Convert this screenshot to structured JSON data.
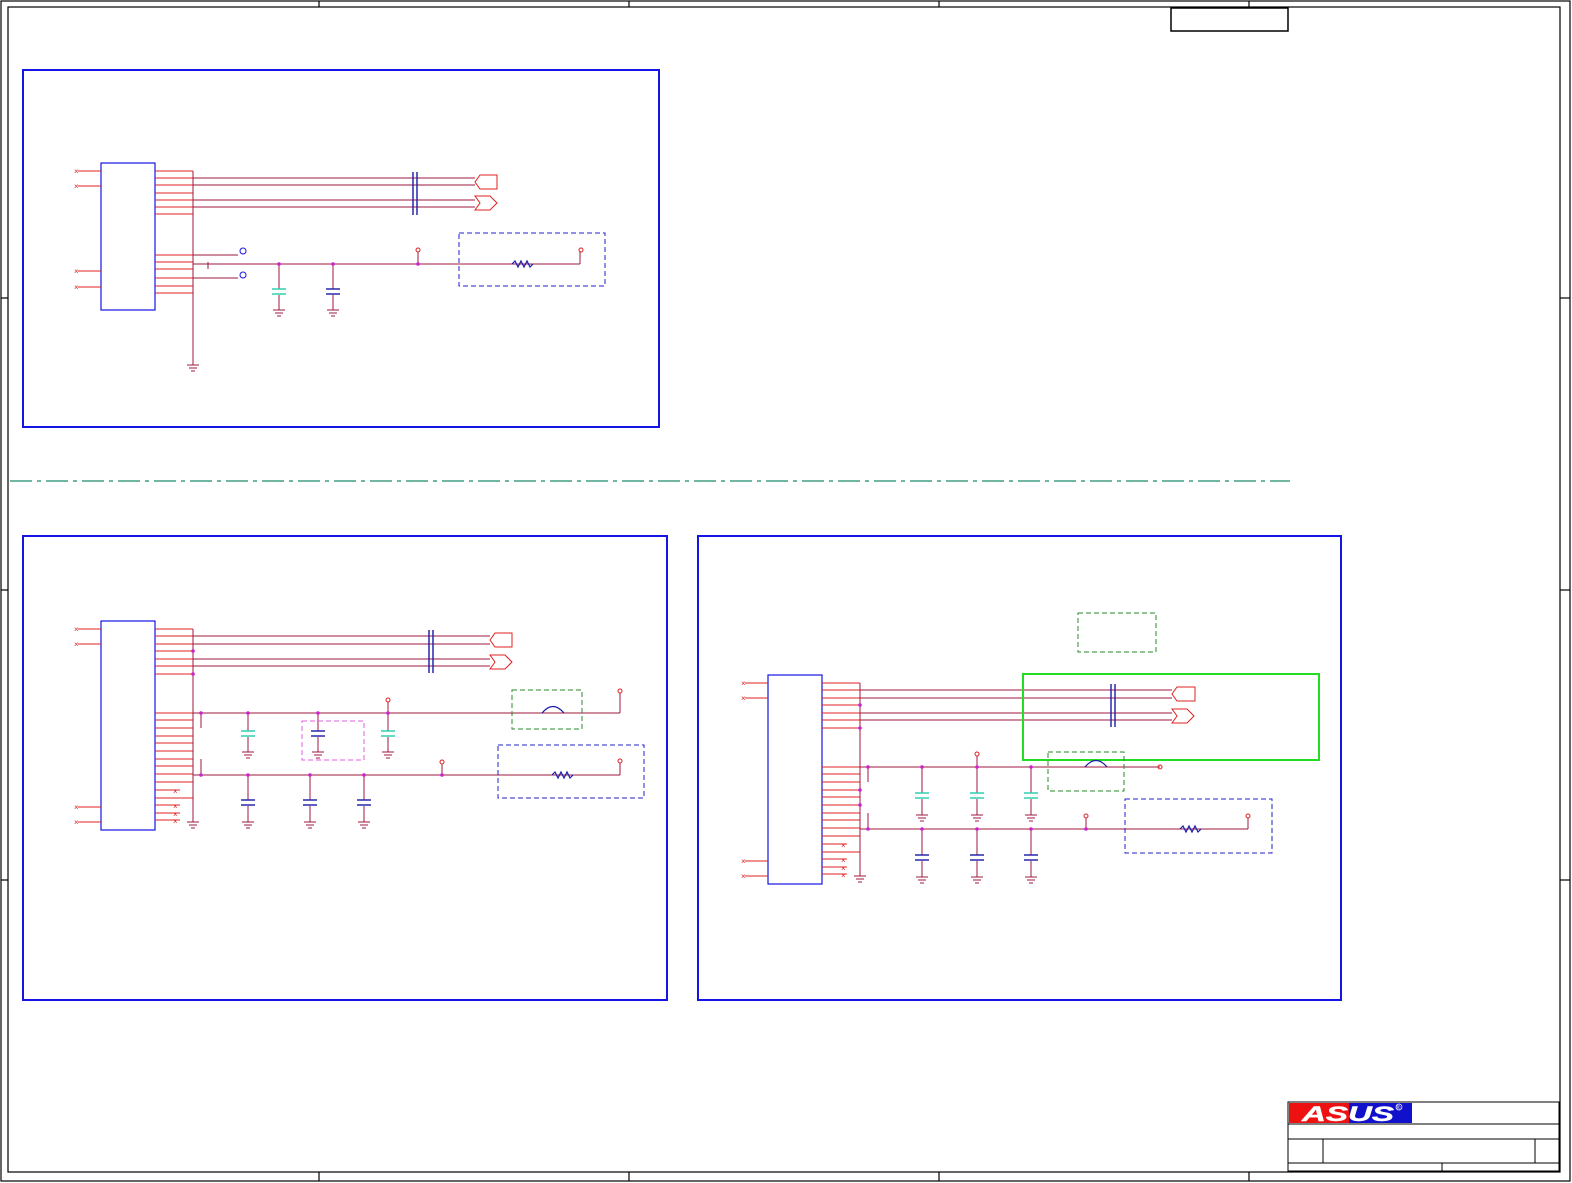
{
  "sheet": {
    "background": "#ffffff",
    "frame_color": "#000000",
    "title_box_text": ""
  },
  "colors": {
    "block_border": "#1515e6",
    "wire": "#9c1a3c",
    "pin": "#e02020",
    "junction": "#cc22cc",
    "cap_green": "#22ccaa",
    "cap_blue": "#1a1aa8",
    "box_green": "#2a8a2a",
    "box_blue": "#2020cc",
    "box_pink": "#e060e0",
    "box_bright_green": "#22dd22",
    "separator": "#1a8a6a"
  },
  "logo": {
    "brand": "ASUS",
    "mark": "®",
    "icon": "asus-logo",
    "colors": [
      "#ee1111",
      "#1111cc",
      "#ffffff"
    ]
  },
  "title_block": {
    "rows": [
      "",
      "",
      ""
    ]
  }
}
